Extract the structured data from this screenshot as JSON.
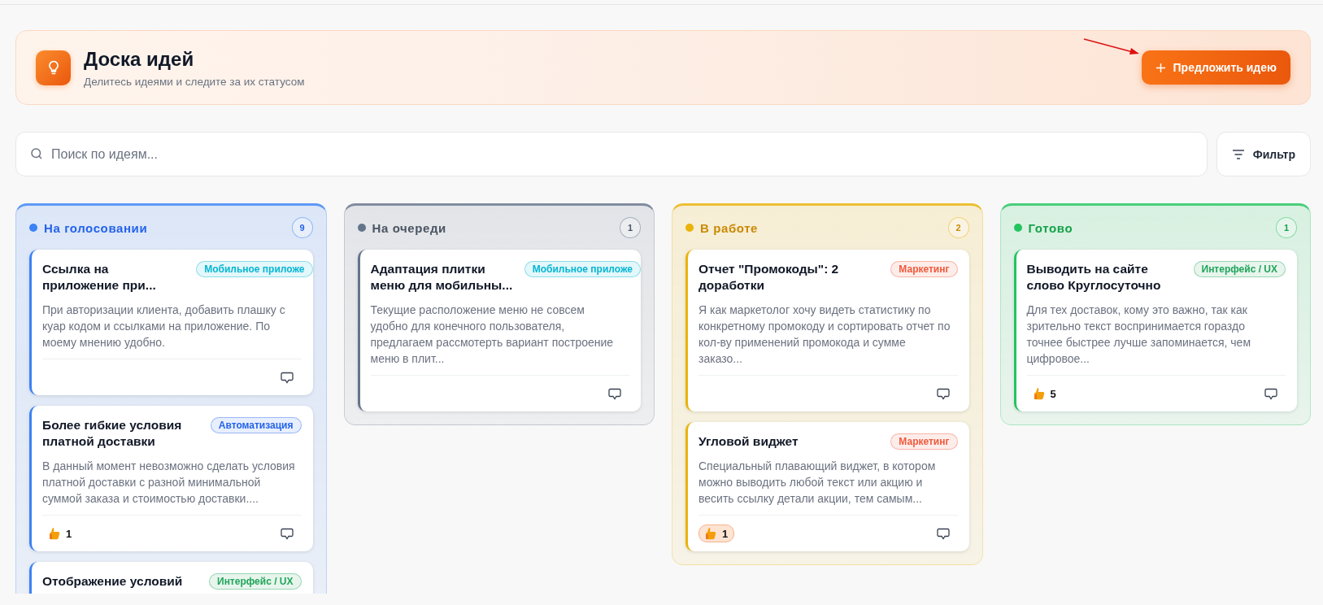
{
  "header": {
    "title": "Доска идей",
    "subtitle": "Делитесь идеями и следите за их статусом",
    "button": "Предложить идею"
  },
  "search": {
    "placeholder": "Поиск по идеям..."
  },
  "filter_button": "Фильтр",
  "columns": [
    {
      "title": "На голосовании",
      "count": "9",
      "color": "#3b82f6",
      "cards": [
        {
          "title": "Ссылка на приложение при...",
          "tag": {
            "label": "Мобильное приложе",
            "color": "#06b6d4"
          },
          "description": "При авторизации клиента, добавить плашку с куар кодом и ссылками на приложение. По моему мнению удобно."
        },
        {
          "title": "Более гибкие условия платной доставки",
          "tag": {
            "label": "Автоматизация",
            "color": "#2563eb"
          },
          "description": "В данный момент невозможно сделать условия платной доставки с разной минимальной суммой заказа и стоимостью доставки....",
          "votes": {
            "count": "1",
            "selected": false
          }
        },
        {
          "title": "Отображение условий",
          "tag": {
            "label": "Интерфейс / UX",
            "color": "#22a55b"
          }
        }
      ]
    },
    {
      "title": "На очереди",
      "count": "1",
      "color": "#64748b",
      "cards": [
        {
          "title": "Адаптация плитки меню для мобильны...",
          "tag": {
            "label": "Мобильное приложе",
            "color": "#06b6d4"
          },
          "description": "Текущие расположение меню не совсем удобно для конечного пользователя, предлагаем рассмотерть вариант построение меню в плит..."
        }
      ]
    },
    {
      "title": "В работе",
      "count": "2",
      "color": "#eab308",
      "cards": [
        {
          "title": "Отчет \"Промокоды\": 2 доработки",
          "tag": {
            "label": "Маркетинг",
            "color": "#f05a3c"
          },
          "description": "Я как маркетолог хочу видеть статистику по конкретному промокоду и сортировать отчет по кол-ву применений промокода и сумме заказо..."
        },
        {
          "title": "Угловой виджет",
          "tag": {
            "label": "Маркетинг",
            "color": "#f05a3c"
          },
          "description": "Специальный плавающий виджет, в котором можно выводить любой текст или акцию и весить ссылку детали акции, тем самым...",
          "votes": {
            "count": "1",
            "selected": true
          }
        }
      ]
    },
    {
      "title": "Готово",
      "count": "1",
      "color": "#22c55e",
      "cards": [
        {
          "title": "Выводить на сайте слово Круглосуточно",
          "tag": {
            "label": "Интерфейс / UX",
            "color": "#22a55b"
          },
          "description": "Для тех доставок, кому это важно, так как зрительно текст воспринимается гораздо точнее быстрее лучше запоминается, чем цифровое...",
          "votes": {
            "count": "5",
            "selected": false
          }
        }
      ]
    }
  ]
}
